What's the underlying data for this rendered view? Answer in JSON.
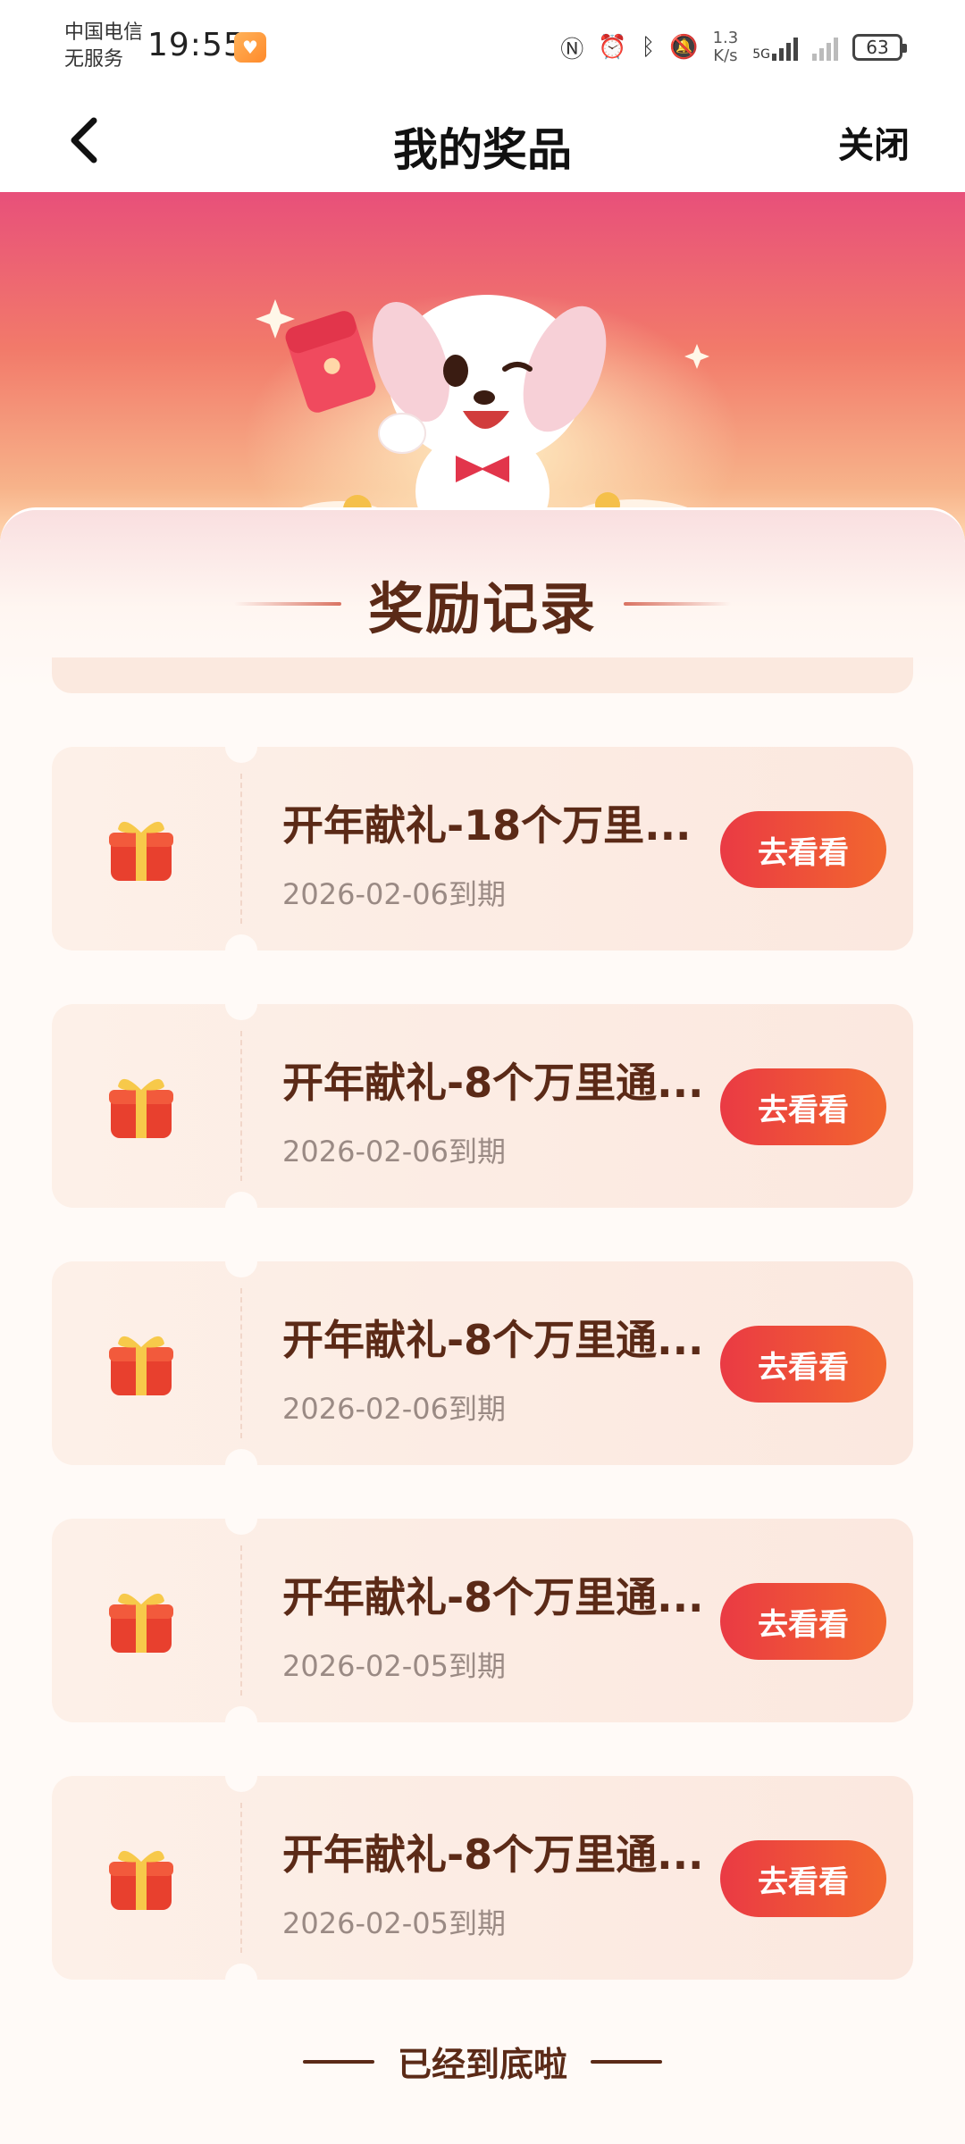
{
  "status_bar": {
    "carrier_line1": "中国电信",
    "carrier_line2": "无服务",
    "time": "19:55",
    "net_speed_value": "1.3",
    "net_speed_unit": "K/s",
    "network_label": "5G",
    "battery": "63",
    "icons": [
      "nfc-icon",
      "alarm-icon",
      "bluetooth-icon",
      "mute-icon",
      "signal-icon"
    ]
  },
  "nav": {
    "title": "我的奖品",
    "close_label": "关闭"
  },
  "records": {
    "title": "奖励记录",
    "items": [
      {
        "title": "开年献礼-18个万里...",
        "date": "2026-02-06到期",
        "button": "去看看"
      },
      {
        "title": "开年献礼-8个万里通...",
        "date": "2026-02-06到期",
        "button": "去看看"
      },
      {
        "title": "开年献礼-8个万里通...",
        "date": "2026-02-06到期",
        "button": "去看看"
      },
      {
        "title": "开年献礼-8个万里通...",
        "date": "2026-02-05到期",
        "button": "去看看"
      },
      {
        "title": "开年献礼-8个万里通...",
        "date": "2026-02-05到期",
        "button": "去看看"
      }
    ],
    "footer": "已经到底啦"
  },
  "colors": {
    "accent": "#ea3a44",
    "title_brown": "#5b2a17",
    "date_gray": "#9a8a84"
  }
}
